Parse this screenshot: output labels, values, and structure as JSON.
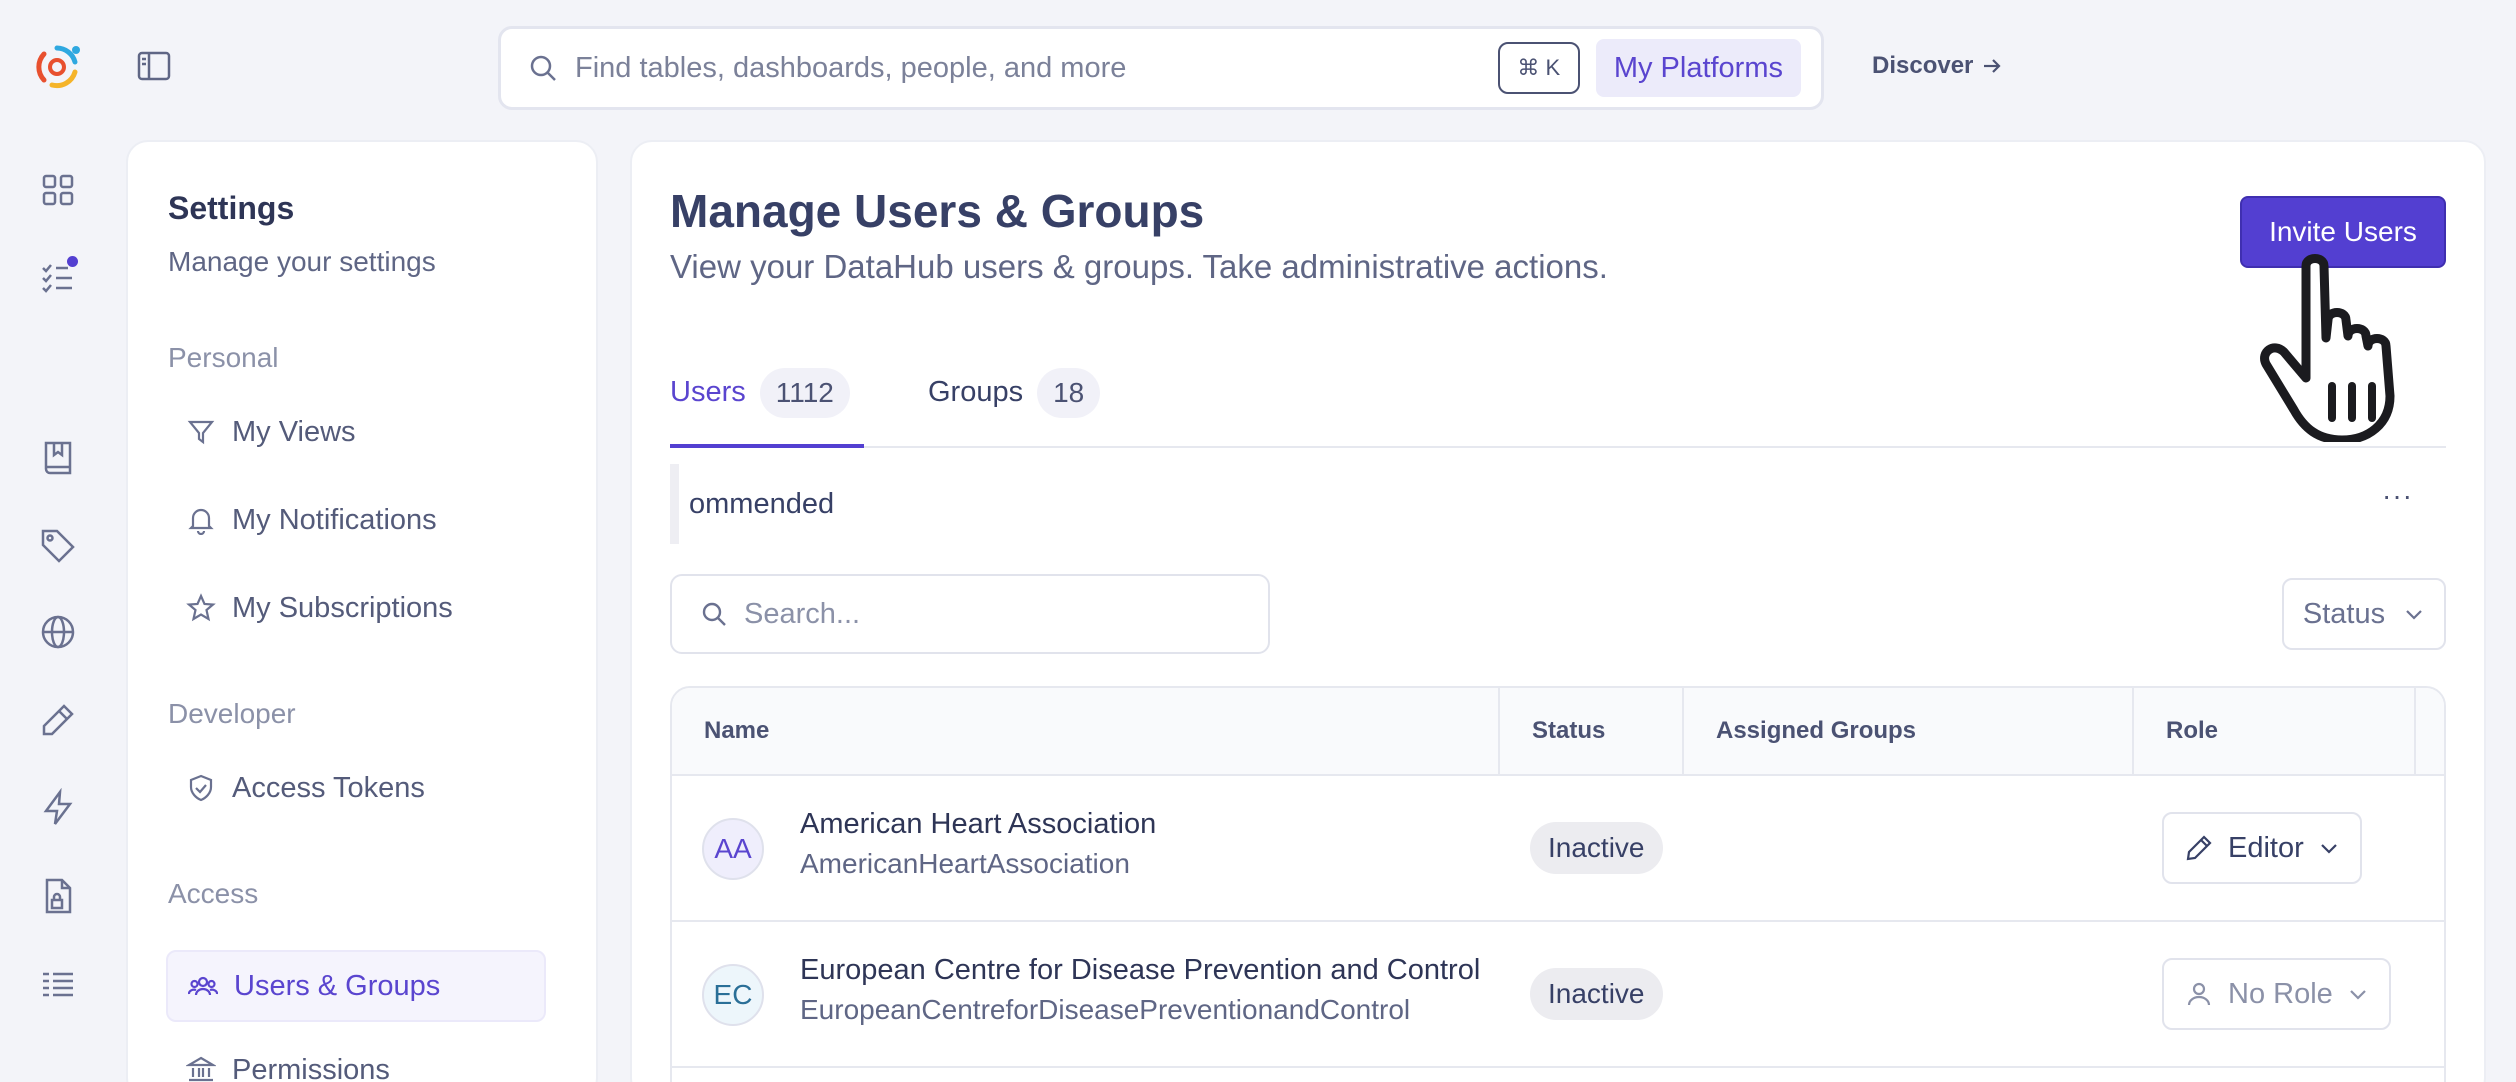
{
  "topbar": {
    "search_placeholder": "Find tables, dashboards, people, and more",
    "shortcut": "⌘ K",
    "platforms_label": "My Platforms",
    "discover_label": "Discover"
  },
  "settings": {
    "title": "Settings",
    "subtitle": "Manage your settings",
    "sections": {
      "personal": "Personal",
      "developer": "Developer",
      "access": "Access"
    },
    "items": {
      "my_views": "My Views",
      "my_notifications": "My Notifications",
      "my_subscriptions": "My Subscriptions",
      "access_tokens": "Access Tokens",
      "users_groups": "Users & Groups",
      "permissions": "Permissions"
    }
  },
  "main": {
    "title": "Manage Users & Groups",
    "description": "View your DataHub users & groups. Take administrative actions.",
    "invite_label": "Invite Users",
    "tabs": [
      {
        "label": "Users",
        "count": "1112"
      },
      {
        "label": "Groups",
        "count": "18"
      }
    ],
    "recommended_label": "ommended",
    "more_label": "···",
    "search_placeholder": "Search...",
    "status_filter": "Status",
    "table": {
      "headers": [
        "Name",
        "Status",
        "Assigned Groups",
        "Role"
      ],
      "rows": [
        {
          "initials": "AA",
          "name": "American Heart Association",
          "handle": "AmericanHeartAssociation",
          "status": "Inactive",
          "role": "Editor"
        },
        {
          "initials": "EC",
          "name": "European Centre for Disease Prevention and Control",
          "handle": "EuropeanCentreforDiseasePreventionandControl",
          "status": "Inactive",
          "role": "No Role"
        }
      ]
    }
  },
  "colors": {
    "accent": "#533fd1",
    "background": "#f3f4f9",
    "panel": "#ffffff",
    "badge_inactive": "#ececf0"
  }
}
